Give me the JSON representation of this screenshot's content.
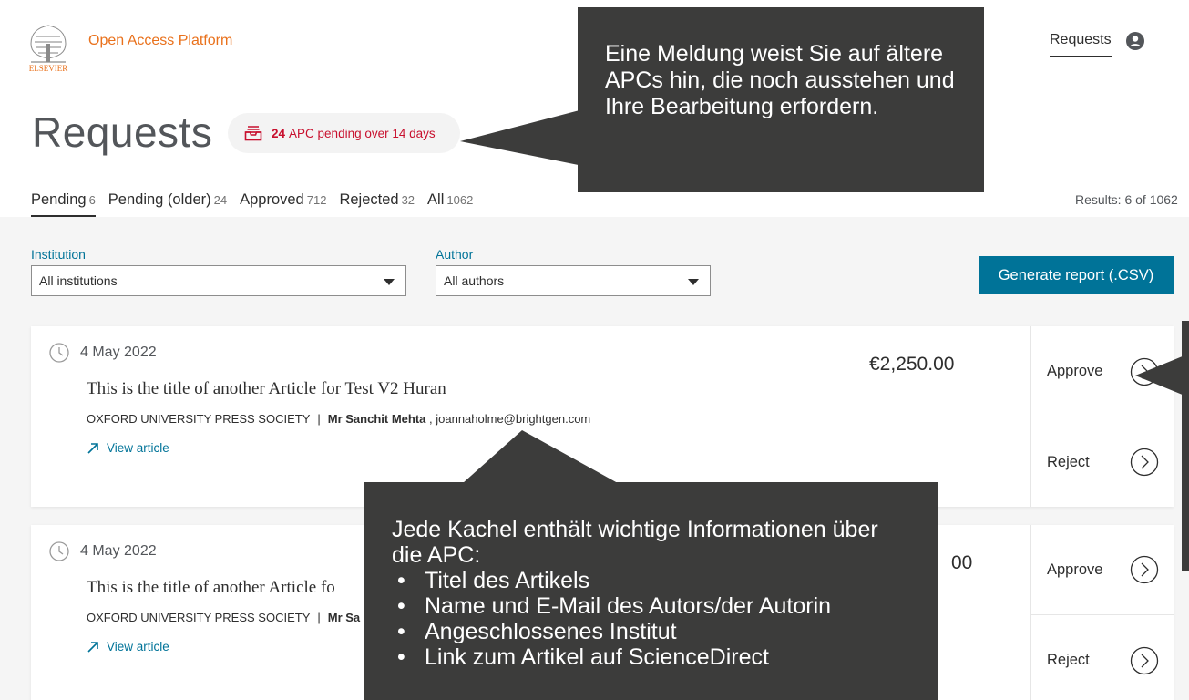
{
  "app": {
    "brand": "Open Access Platform",
    "logo_text": "ELSEVIER",
    "nav_requests": "Requests",
    "user_icon": "user-circle-icon"
  },
  "page": {
    "title": "Requests",
    "badge": {
      "count": "24",
      "text": "APC pending over 14 days",
      "icon": "inbox-tray-icon"
    },
    "results": "Results: 6 of 1062"
  },
  "tabs": [
    {
      "label": "Pending",
      "count": "6",
      "active": true
    },
    {
      "label": "Pending (older)",
      "count": "24",
      "active": false
    },
    {
      "label": "Approved",
      "count": "712",
      "active": false
    },
    {
      "label": "Rejected",
      "count": "32",
      "active": false
    },
    {
      "label": "All",
      "count": "1062",
      "active": false
    }
  ],
  "filters": {
    "institution_label": "Institution",
    "institution_value": "All institutions",
    "author_label": "Author",
    "author_value": "All authors",
    "generate_button": "Generate report (.CSV)"
  },
  "cards": [
    {
      "date": "4 May 2022",
      "title": "This is the title of another Article for Test V2 Huran",
      "publisher": "OXFORD UNIVERSITY PRESS SOCIETY",
      "author": "Mr Sanchit Mehta",
      "email": ", joannaholme@brightgen.com",
      "link": "View article",
      "price": "€2,250.00",
      "approve": "Approve",
      "reject": "Reject"
    },
    {
      "date": "4 May 2022",
      "title": "This is the title of another Article fo",
      "publisher": "OXFORD UNIVERSITY PRESS SOCIETY",
      "author": "Mr Sa",
      "email": "",
      "link": "View article",
      "price": "00",
      "approve": "Approve",
      "reject": "Reject"
    }
  ],
  "callouts": {
    "top": "Eine Meldung weist Sie auf ältere APCs hin, die noch ausstehen und Ihre Bearbeitung erfordern.",
    "bottom_intro": "Jede Kachel enthält wichtige Informationen über die APC:",
    "bottom_items": [
      "Titel des Artikels",
      "Name und E-Mail des Autors/der Autorin",
      "Angeschlossenes Institut",
      "Link zum Artikel auf ScienceDirect"
    ]
  },
  "colors": {
    "accent": "#007398",
    "brand": "#e9711c",
    "alert": "#c8102e",
    "callout": "#3c3c3b"
  }
}
